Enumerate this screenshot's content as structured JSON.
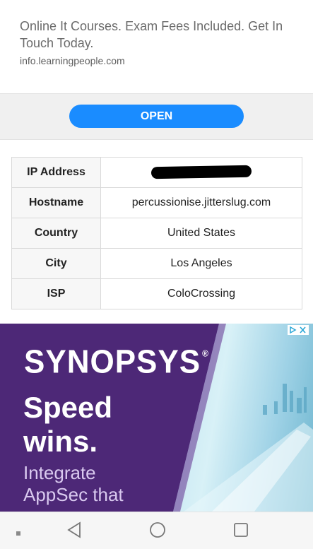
{
  "ad_top": {
    "headline": "Online It Courses. Exam Fees Included. Get In Touch Today.",
    "url": "info.learningpeople.com",
    "button_label": "OPEN"
  },
  "ip_table": {
    "rows": [
      {
        "key": "IP Address",
        "value": ""
      },
      {
        "key": "Hostname",
        "value": "percussionise.jitterslug.com"
      },
      {
        "key": "Country",
        "value": "United States"
      },
      {
        "key": "City",
        "value": "Los Angeles"
      },
      {
        "key": "ISP",
        "value": "ColoCrossing"
      }
    ]
  },
  "banner_ad": {
    "brand": "SYNOPSYS",
    "brand_mark": "®",
    "headline_line1": "Speed",
    "headline_line2": "wins.",
    "subtext_line1": "Integrate",
    "subtext_line2": "AppSec that",
    "adchoices_icon": "adchoices-icon",
    "colors": {
      "purple": "#4b2773",
      "sky": "#bfe2f0"
    }
  },
  "navbar": {
    "icons": [
      "menu-dot-icon",
      "back-icon",
      "home-icon",
      "recents-icon"
    ]
  },
  "colors": {
    "accent": "#1a8cff",
    "table_key_bg": "#f7f7f7"
  }
}
